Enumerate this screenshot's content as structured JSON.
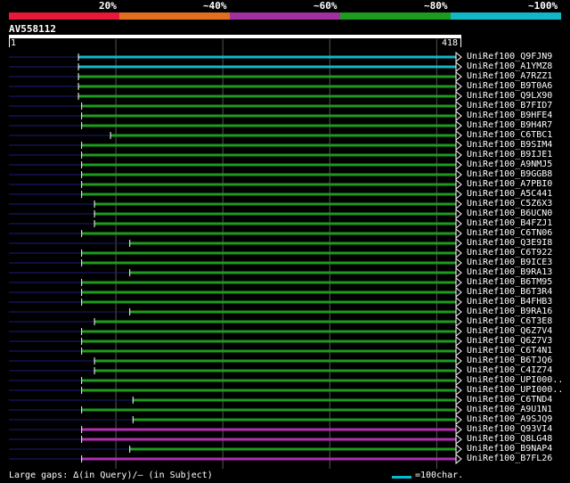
{
  "query": {
    "id": "AV558112",
    "start": "1",
    "end": "418",
    "length": 418
  },
  "identity_legend": [
    {
      "label": "20%",
      "color": "#e8183a"
    },
    {
      "label": "~40%",
      "color": "#e07020"
    },
    {
      "label": "~60%",
      "color": "#a030a0"
    },
    {
      "label": "~80%",
      "color": "#1e9a1e"
    },
    {
      "label": "~100%",
      "color": "#10b8c8"
    }
  ],
  "hits": [
    {
      "name": "UniRef100_Q9FJN9",
      "start": 65,
      "end": 418,
      "color": "#10b8c8"
    },
    {
      "name": "UniRef100_A1YMZ8",
      "start": 65,
      "end": 418,
      "color": "#10b8c8"
    },
    {
      "name": "UniRef100_A7RZZ1",
      "start": 65,
      "end": 418,
      "color": "#1e9a1e"
    },
    {
      "name": "UniRef100_B9T0A6",
      "start": 65,
      "end": 418,
      "color": "#1e9a1e"
    },
    {
      "name": "UniRef100_Q9LX90",
      "start": 65,
      "end": 418,
      "color": "#1e9a1e"
    },
    {
      "name": "UniRef100_B7FID7",
      "start": 68,
      "end": 418,
      "color": "#1e9a1e"
    },
    {
      "name": "UniRef100_B9HFE4",
      "start": 68,
      "end": 418,
      "color": "#1e9a1e"
    },
    {
      "name": "UniRef100_B9H4R7",
      "start": 68,
      "end": 418,
      "color": "#1e9a1e"
    },
    {
      "name": "UniRef100_C6TBC1",
      "start": 95,
      "end": 418,
      "color": "#1e9a1e"
    },
    {
      "name": "UniRef100_B9SIM4",
      "start": 68,
      "end": 418,
      "color": "#1e9a1e"
    },
    {
      "name": "UniRef100_B9IJE1",
      "start": 68,
      "end": 418,
      "color": "#1e9a1e"
    },
    {
      "name": "UniRef100_A9NMJ5",
      "start": 68,
      "end": 418,
      "color": "#1e9a1e"
    },
    {
      "name": "UniRef100_B9GGB8",
      "start": 68,
      "end": 418,
      "color": "#1e9a1e"
    },
    {
      "name": "UniRef100_A7PBI0",
      "start": 68,
      "end": 418,
      "color": "#1e9a1e"
    },
    {
      "name": "UniRef100_A5C441",
      "start": 68,
      "end": 418,
      "color": "#1e9a1e"
    },
    {
      "name": "UniRef100_C5Z6X3",
      "start": 80,
      "end": 418,
      "color": "#1e9a1e"
    },
    {
      "name": "UniRef100_B6UCN0",
      "start": 80,
      "end": 418,
      "color": "#1e9a1e"
    },
    {
      "name": "UniRef100_B4FZJ1",
      "start": 80,
      "end": 418,
      "color": "#1e9a1e"
    },
    {
      "name": "UniRef100_C6TN06",
      "start": 68,
      "end": 418,
      "color": "#1e9a1e"
    },
    {
      "name": "UniRef100_Q3E9I8",
      "start": 113,
      "end": 418,
      "color": "#1e9a1e"
    },
    {
      "name": "UniRef100_C6T922",
      "start": 68,
      "end": 418,
      "color": "#1e9a1e"
    },
    {
      "name": "UniRef100_B9ICE3",
      "start": 68,
      "end": 418,
      "color": "#1e9a1e"
    },
    {
      "name": "UniRef100_B9RA13",
      "start": 113,
      "end": 418,
      "color": "#1e9a1e"
    },
    {
      "name": "UniRef100_B6TM95",
      "start": 68,
      "end": 418,
      "color": "#1e9a1e"
    },
    {
      "name": "UniRef100_B6T3R4",
      "start": 68,
      "end": 418,
      "color": "#1e9a1e"
    },
    {
      "name": "UniRef100_B4FHB3",
      "start": 68,
      "end": 418,
      "color": "#1e9a1e"
    },
    {
      "name": "UniRef100_B9RA16",
      "start": 113,
      "end": 418,
      "color": "#1e9a1e"
    },
    {
      "name": "UniRef100_C6T3E8",
      "start": 80,
      "end": 418,
      "color": "#1e9a1e"
    },
    {
      "name": "UniRef100_Q6Z7V4",
      "start": 68,
      "end": 418,
      "color": "#1e9a1e"
    },
    {
      "name": "UniRef100_Q6Z7V3",
      "start": 68,
      "end": 418,
      "color": "#1e9a1e"
    },
    {
      "name": "UniRef100_C6T4N1",
      "start": 68,
      "end": 418,
      "color": "#1e9a1e"
    },
    {
      "name": "UniRef100_B6TJQ6",
      "start": 80,
      "end": 418,
      "color": "#1e9a1e"
    },
    {
      "name": "UniRef100_C4IZ74",
      "start": 80,
      "end": 418,
      "color": "#1e9a1e"
    },
    {
      "name": "UniRef100_UPI000..",
      "start": 68,
      "end": 418,
      "color": "#1e9a1e"
    },
    {
      "name": "UniRef100_UPI000..",
      "start": 68,
      "end": 418,
      "color": "#1e9a1e"
    },
    {
      "name": "UniRef100_C6TND4",
      "start": 116,
      "end": 418,
      "color": "#1e9a1e"
    },
    {
      "name": "UniRef100_A9U1N1",
      "start": 68,
      "end": 418,
      "color": "#1e9a1e"
    },
    {
      "name": "UniRef100_A9SJQ9",
      "start": 116,
      "end": 418,
      "color": "#1e9a1e"
    },
    {
      "name": "UniRef100_Q93VI4",
      "start": 68,
      "end": 418,
      "color": "#b030b0"
    },
    {
      "name": "UniRef100_Q8LG48",
      "start": 68,
      "end": 418,
      "color": "#b030b0"
    },
    {
      "name": "UniRef100_B9NAP4",
      "start": 113,
      "end": 418,
      "color": "#1e9a1e"
    },
    {
      "name": "UniRef100_B7FL26",
      "start": 68,
      "end": 418,
      "color": "#b030b0"
    }
  ],
  "footer": {
    "text": "Large gaps: ∆(in Query)/– (in Subject)",
    "scale_text": "=100char."
  },
  "colors": {
    "unaligned": "#1c1c7a",
    "grid": "#555555",
    "gap": "#ffffff"
  }
}
